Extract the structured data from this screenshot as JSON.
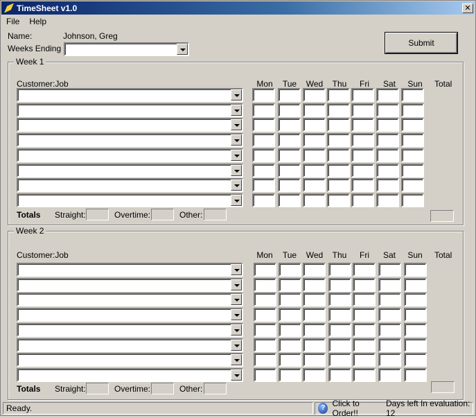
{
  "window": {
    "title": "TimeSheet v1.0",
    "icon": "timesheet-app-icon"
  },
  "menu": {
    "file": "File",
    "help": "Help"
  },
  "header": {
    "name_label": "Name:",
    "name_value": "Johnson, Greg",
    "weeks_ending_label": "Weeks Ending",
    "weeks_ending_value": "",
    "submit_label": "Submit"
  },
  "columns": {
    "customer_job": "Customer:Job",
    "days": [
      "Mon",
      "Tue",
      "Wed",
      "Thu",
      "Fri",
      "Sat",
      "Sun"
    ],
    "total": "Total"
  },
  "weeks": [
    {
      "title": "Week 1",
      "rows": 8
    },
    {
      "title": "Week 2",
      "rows": 8
    }
  ],
  "totals": {
    "label": "Totals",
    "straight": "Straight:",
    "overtime": "Overtime:",
    "other": "Other:"
  },
  "status": {
    "text": "Ready.",
    "order_text": "Click to Order!!",
    "evaluation_text": "Days left In evaluation: 12"
  }
}
